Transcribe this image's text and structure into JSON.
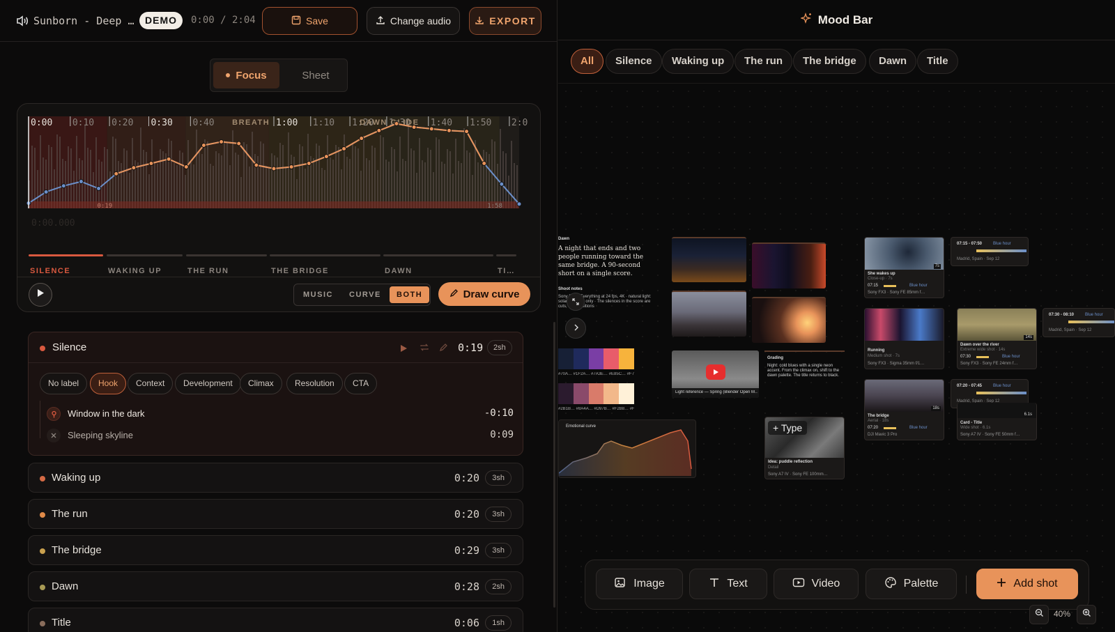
{
  "header": {
    "track_title": "Sunborn - Deep …",
    "demo_badge": "DEMO",
    "time_readout": "0:00 / 2:04",
    "save_label": "Save",
    "change_audio_label": "Change audio",
    "export_label": "EXPORT"
  },
  "view_toggle": {
    "focus": "Focus",
    "sheet": "Sheet",
    "selected": "Focus"
  },
  "timeline": {
    "ticks": [
      "0:00",
      "0:10",
      "0:20",
      "0:30",
      "0:40",
      "1:00",
      "1:10",
      "1:20",
      "1:30",
      "1:40",
      "1:50",
      "2:0"
    ],
    "markers": [
      "BREATH",
      "DAWN GLIDE"
    ],
    "start_marker": "0:19",
    "end_marker": "1:58",
    "position_readout": "0:00.000",
    "sections": [
      "SILENCE",
      "WAKING UP",
      "THE RUN",
      "THE BRIDGE",
      "DAWN",
      "TI…"
    ],
    "curve_values": [
      0.06,
      0.19,
      0.26,
      0.31,
      0.23,
      0.4,
      0.47,
      0.52,
      0.57,
      0.48,
      0.73,
      0.77,
      0.75,
      0.5,
      0.46,
      0.48,
      0.52,
      0.6,
      0.69,
      0.81,
      0.9,
      0.98,
      0.94,
      0.92,
      0.9,
      0.89,
      0.52,
      0.28,
      0.05
    ]
  },
  "playback": {
    "mode_music": "MUSIC",
    "mode_curve": "CURVE",
    "mode_both": "BOTH",
    "mode_selected": "BOTH",
    "draw_curve_label": "Draw curve"
  },
  "scenes": [
    {
      "name": "Silence",
      "time": "0:19",
      "shots": "2sh",
      "color": "#d9593f",
      "expanded": true,
      "labels": [
        "No label",
        "Hook",
        "Context",
        "Development",
        "Climax",
        "Resolution",
        "CTA"
      ],
      "active_label": "Hook",
      "items": [
        {
          "name": "Window in the dark",
          "time": "-0:10"
        },
        {
          "name": "Sleeping skyline",
          "time": "0:09"
        }
      ]
    },
    {
      "name": "Waking up",
      "time": "0:20",
      "shots": "3sh",
      "color": "#d46a45"
    },
    {
      "name": "The run",
      "time": "0:20",
      "shots": "3sh",
      "color": "#e08a48"
    },
    {
      "name": "The bridge",
      "time": "0:29",
      "shots": "3sh",
      "color": "#c9a04e"
    },
    {
      "name": "Dawn",
      "time": "0:28",
      "shots": "2sh",
      "color": "#a89a55"
    },
    {
      "name": "Title",
      "time": "0:06",
      "shots": "1sh",
      "color": "#8a6d5c"
    }
  ],
  "moodbar": {
    "title": "Mood Bar",
    "filters": [
      "All",
      "Silence",
      "Waking up",
      "The run",
      "The bridge",
      "Dawn",
      "Title"
    ],
    "active_filter": "All"
  },
  "board": {
    "note_heading": "Dawn",
    "note_body": "A night that ends and two people running toward the same bridge. A 90-second short on a single score.",
    "shoot_heading": "Shoot notes",
    "shoot_body": "Sony FX3 · Everything at 24 fps, 4K · natural light: solar windows only · The silences in the score are cuts, not transitions",
    "palette_1_codes": "#70A… #1F2A… #7A3E… #E85C… #F7B3…",
    "palette_2_codes": "#2B1B… #8A4A… #D97B… #F2B8… #FFF1…",
    "video_caption": "Light reference — Spring (Blender Open M…",
    "grading_heading": "Grading",
    "grading_body": "Night: cold blues with a single neon accent. From the climax on, shift to the dawn palette. The title returns to black.",
    "emotional_curve_label": "Emotional curve",
    "type_badge": "+ Type",
    "puddle_title": "Idea: puddle reflection",
    "puddle_sub": "Detail",
    "puddle_tags": "Sony A7 IV · Sony FE 100mm…",
    "shots": [
      {
        "title": "She wakes up",
        "sub": "Close-up · 7s",
        "time": "07:15",
        "tag": "Blue hour",
        "gear": "Sony FX3 · Sony FE 85mm f…",
        "dur": "7s"
      },
      {
        "title": "Running",
        "sub": "Medium shot · 7s",
        "time": "",
        "tag": "",
        "gear": "Sony FX3 · Sigma 35mm f/1…",
        "dur": ""
      },
      {
        "title": "Dawn over the river",
        "sub": "Extreme wide shot · 14s",
        "time": "07:30",
        "tag": "Blue hour",
        "gear": "Sony FX3 · Sony FE 24mm f…",
        "dur": "14s"
      },
      {
        "title": "The bridge",
        "sub": "Aerial · 18s",
        "time": "07:20",
        "tag": "Blue hour",
        "gear": "DJI Mavic 3 Pro",
        "dur": "18s"
      },
      {
        "title": "Card - Title",
        "sub": "Wide shot · 6.1s",
        "time": "",
        "tag": "",
        "gear": "Sony A7 IV · Sony FE 50mm f…",
        "dur": "6.1s"
      }
    ],
    "timeslots": [
      {
        "range": "07:15 - 07:50",
        "tag": "Blue hour",
        "place": "Madrid, Spain · Sep 12"
      },
      {
        "range": "07:30 - 08:10",
        "tag": "Blue hour",
        "place": "Madrid, Spain · Sep 12"
      },
      {
        "range": "07:20 - 07:45",
        "tag": "Blue hour",
        "place": "Madrid, Spain · Sep 12"
      }
    ]
  },
  "toolbar": {
    "image": "Image",
    "text": "Text",
    "video": "Video",
    "palette": "Palette",
    "add_shot": "Add shot",
    "zoom": "40%"
  },
  "colors": {
    "accent": "#e8935a",
    "accent_dark": "#c0603a",
    "background": "#0b0b0b",
    "curve_orange": "#e8935a",
    "curve_blue": "#6b8fc9"
  }
}
